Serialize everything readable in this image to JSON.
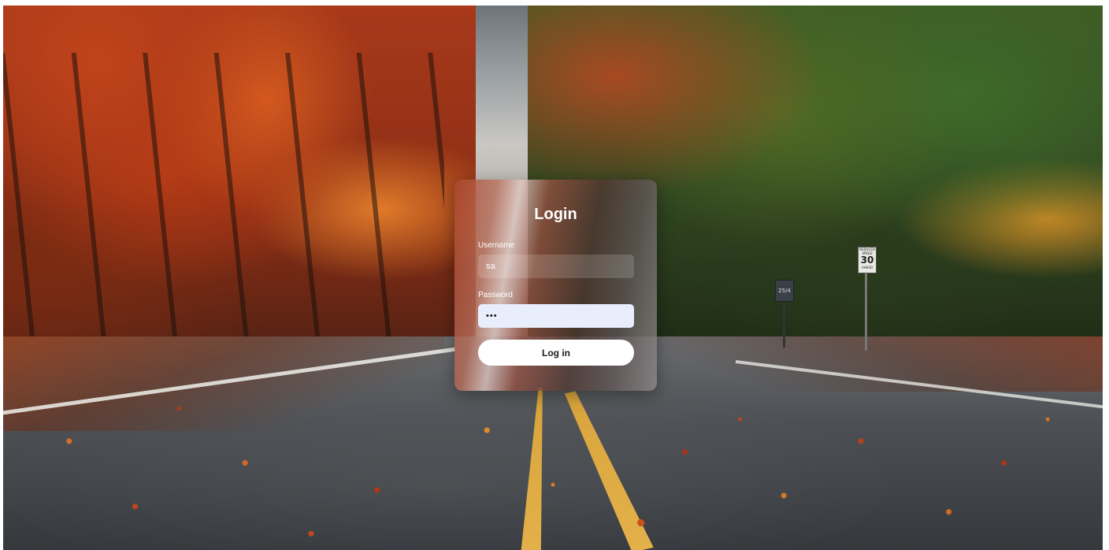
{
  "login": {
    "title": "Login",
    "username_label": "Username",
    "username_value": "sa",
    "password_label": "Password",
    "password_value": "•••",
    "submit_label": "Log in"
  },
  "background": {
    "speed_sign_top": "REDUCED SPEED",
    "speed_sign_value": "30",
    "speed_sign_bottom": "AHEAD",
    "small_sign_text": "25/4"
  }
}
